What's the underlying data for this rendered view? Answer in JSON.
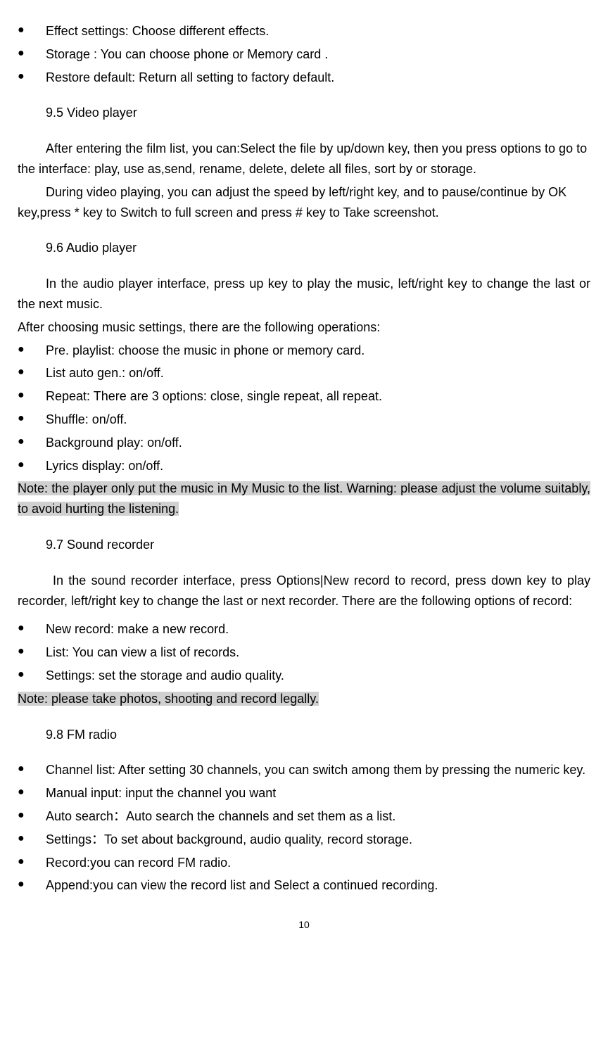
{
  "topBullets": [
    "Effect settings: Choose different effects.",
    "Storage : You can choose phone or Memory card .",
    "Restore default: Return all setting to factory default."
  ],
  "s95": {
    "heading": "9.5 Video player",
    "p1": "After entering the film list, you can:Select the file by up/down key, then you press options to go to the interface: play, use as,send, rename, delete, delete all files, sort by or storage.",
    "p2": "During video playing, you can adjust the speed by left/right key, and to pause/continue by OK key,press * key to Switch to full screen and press # key to Take screenshot."
  },
  "s96": {
    "heading": "9.6 Audio player",
    "p1": "In the audio player interface, press up key to play the music, left/right key to change the last or the next music.",
    "p2": "After choosing music settings, there are the following operations:",
    "bullets": [
      "Pre. playlist: choose the music in phone or memory card.",
      "List auto gen.: on/off.",
      "Repeat: There are 3 options: close, single repeat, all repeat.",
      "Shuffle: on/off.",
      "Background play: on/off.",
      "Lyrics display: on/off."
    ],
    "note": "Note: the player only put the music in My Music to the list. Warning: please adjust the volume suitably, to avoid hurting the listening."
  },
  "s97": {
    "heading": "9.7 Sound recorder",
    "p1": "In the sound recorder interface, press Options|New record to record, press down key to play recorder, left/right key to change the last or next recorder. There are the following options of record:",
    "bullets": [
      "New record: make a new record.",
      "List: You can view a list of records.",
      "Settings: set the storage and audio quality."
    ],
    "note": "Note: please take photos, shooting and record legally."
  },
  "s98": {
    "heading": "9.8 FM radio",
    "bullets": [
      "Channel list: After setting 30 channels, you can switch among them by pressing the numeric key.",
      "Manual input: input the channel you want",
      "Auto search：Auto search the channels and set them as a list.",
      "Settings：To set about background, audio quality, record storage.",
      "Record:you can record FM radio.",
      "Append:you can view the record list and Select a continued recording."
    ]
  },
  "pageNumber": "10"
}
